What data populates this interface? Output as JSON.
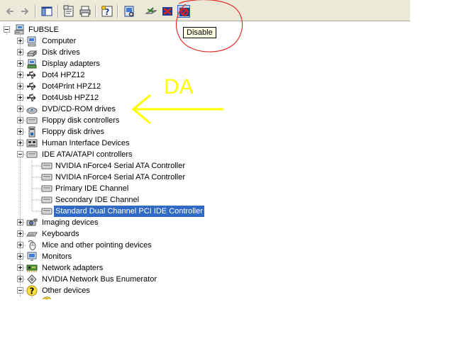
{
  "toolbar": {
    "buttons": [
      {
        "icon": "back-arrow-icon",
        "enabled": false
      },
      {
        "icon": "forward-arrow-icon",
        "enabled": false
      },
      {
        "icon": "show-hide-console-tree-icon",
        "enabled": true
      },
      {
        "icon": "properties-icon",
        "enabled": true
      },
      {
        "icon": "print-icon",
        "enabled": true
      },
      {
        "icon": "help-icon",
        "enabled": true
      },
      {
        "icon": "scan-hardware-changes-icon",
        "enabled": true
      },
      {
        "icon": "update-driver-icon",
        "enabled": true
      },
      {
        "icon": "uninstall-icon",
        "enabled": true
      },
      {
        "icon": "disable-icon",
        "enabled": true
      }
    ],
    "tooltip": "Disable"
  },
  "tree": {
    "root": "FUBSLE",
    "items": [
      {
        "label": "Computer",
        "icon": "computer-icon",
        "expanded": false
      },
      {
        "label": "Disk drives",
        "icon": "disk-drive-icon",
        "expanded": false
      },
      {
        "label": "Display adapters",
        "icon": "display-adapter-icon",
        "expanded": false
      },
      {
        "label": "Dot4 HPZ12",
        "icon": "usb-icon",
        "expanded": false
      },
      {
        "label": "Dot4Print HPZ12",
        "icon": "usb-icon",
        "expanded": false
      },
      {
        "label": "Dot4Usb HPZ12",
        "icon": "usb-icon",
        "expanded": false
      },
      {
        "label": "DVD/CD-ROM drives",
        "icon": "cd-rom-icon",
        "expanded": false
      },
      {
        "label": "Floppy disk controllers",
        "icon": "controller-icon",
        "expanded": false
      },
      {
        "label": "Floppy disk drives",
        "icon": "floppy-drive-icon",
        "expanded": false
      },
      {
        "label": "Human Interface Devices",
        "icon": "hid-icon",
        "expanded": false
      },
      {
        "label": "IDE ATA/ATAPI controllers",
        "icon": "controller-icon",
        "expanded": true,
        "children": [
          {
            "label": "NVIDIA nForce4 Serial ATA Controller",
            "icon": "controller-icon",
            "selected": false
          },
          {
            "label": "NVIDIA nForce4 Serial ATA Controller",
            "icon": "controller-icon",
            "selected": false
          },
          {
            "label": "Primary IDE Channel",
            "icon": "controller-icon",
            "selected": false
          },
          {
            "label": "Secondary IDE Channel",
            "icon": "controller-icon",
            "selected": false
          },
          {
            "label": "Standard Dual Channel PCI IDE Controller",
            "icon": "controller-icon",
            "selected": true
          }
        ]
      },
      {
        "label": "Imaging devices",
        "icon": "camera-icon",
        "expanded": false
      },
      {
        "label": "Keyboards",
        "icon": "keyboard-icon",
        "expanded": false
      },
      {
        "label": "Mice and other pointing devices",
        "icon": "mouse-icon",
        "expanded": false
      },
      {
        "label": "Monitors",
        "icon": "monitor-icon",
        "expanded": false
      },
      {
        "label": "Network adapters",
        "icon": "network-adapter-icon",
        "expanded": false
      },
      {
        "label": "NVIDIA Network Bus Enumerator",
        "icon": "diamond-icon",
        "expanded": false
      },
      {
        "label": "Other devices",
        "icon": "question-mark-icon",
        "expanded": true
      }
    ]
  },
  "annotation": {
    "text": "DA",
    "color": "#ffff00",
    "circle_color": "#e0302a"
  },
  "colors": {
    "selection": "#316ac5",
    "toolbar": "#ece9d8"
  }
}
